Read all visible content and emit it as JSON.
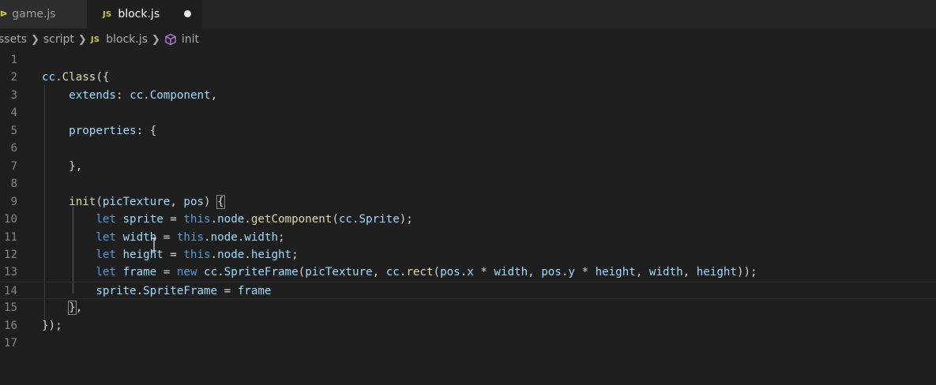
{
  "tabs": [
    {
      "label": "game.js",
      "icon": "js-file-icon",
      "active": false
    },
    {
      "label": "block.js",
      "icon": "js-file-icon",
      "active": true,
      "modified": true
    }
  ],
  "breadcrumb": {
    "segments": [
      "ssets",
      "script",
      "block.js",
      "init"
    ],
    "js_icon_text": "JS"
  },
  "editor": {
    "lines": [
      {
        "n": "1",
        "tokens": []
      },
      {
        "n": "2",
        "tokens": [
          [
            "id",
            "cc"
          ],
          [
            "punc",
            "."
          ],
          [
            "fn",
            "Class"
          ],
          [
            "punc",
            "({"
          ]
        ]
      },
      {
        "n": "3",
        "tokens": [
          [
            "punc",
            "    "
          ],
          [
            "id",
            "extends"
          ],
          [
            "punc",
            ": "
          ],
          [
            "id",
            "cc"
          ],
          [
            "punc",
            "."
          ],
          [
            "id",
            "Component"
          ],
          [
            "punc",
            ","
          ]
        ]
      },
      {
        "n": "4",
        "tokens": []
      },
      {
        "n": "5",
        "tokens": [
          [
            "punc",
            "    "
          ],
          [
            "id",
            "properties"
          ],
          [
            "punc",
            ": {"
          ]
        ]
      },
      {
        "n": "6",
        "tokens": []
      },
      {
        "n": "7",
        "tokens": [
          [
            "punc",
            "    },"
          ]
        ]
      },
      {
        "n": "8",
        "tokens": []
      },
      {
        "n": "9",
        "tokens": [
          [
            "punc",
            "    "
          ],
          [
            "fn",
            "init"
          ],
          [
            "punc",
            "("
          ],
          [
            "id",
            "picTexture"
          ],
          [
            "punc",
            ", "
          ],
          [
            "id",
            "pos"
          ],
          [
            "punc",
            ") "
          ],
          [
            "hl",
            "{"
          ]
        ]
      },
      {
        "n": "10",
        "tokens": [
          [
            "punc",
            "        "
          ],
          [
            "kw",
            "let"
          ],
          [
            "punc",
            " "
          ],
          [
            "id",
            "sprite"
          ],
          [
            "punc",
            " = "
          ],
          [
            "kw",
            "this"
          ],
          [
            "punc",
            "."
          ],
          [
            "id",
            "node"
          ],
          [
            "punc",
            "."
          ],
          [
            "fn",
            "getComponent"
          ],
          [
            "punc",
            "("
          ],
          [
            "id",
            "cc"
          ],
          [
            "punc",
            "."
          ],
          [
            "id",
            "Sprite"
          ],
          [
            "punc",
            ");"
          ]
        ]
      },
      {
        "n": "11",
        "tokens": [
          [
            "punc",
            "        "
          ],
          [
            "kw",
            "let"
          ],
          [
            "punc",
            " "
          ],
          [
            "id",
            "width"
          ],
          [
            "punc",
            " = "
          ],
          [
            "kw",
            "this"
          ],
          [
            "punc",
            "."
          ],
          [
            "id",
            "node"
          ],
          [
            "punc",
            "."
          ],
          [
            "id",
            "width"
          ],
          [
            "punc",
            ";"
          ]
        ]
      },
      {
        "n": "12",
        "tokens": [
          [
            "punc",
            "        "
          ],
          [
            "kw",
            "let"
          ],
          [
            "punc",
            " "
          ],
          [
            "id",
            "height"
          ],
          [
            "punc",
            " = "
          ],
          [
            "kw",
            "this"
          ],
          [
            "punc",
            "."
          ],
          [
            "id",
            "node"
          ],
          [
            "punc",
            "."
          ],
          [
            "id",
            "height"
          ],
          [
            "punc",
            ";"
          ]
        ]
      },
      {
        "n": "13",
        "tokens": [
          [
            "punc",
            "        "
          ],
          [
            "kw",
            "let"
          ],
          [
            "punc",
            " "
          ],
          [
            "id",
            "frame"
          ],
          [
            "punc",
            " = "
          ],
          [
            "kw",
            "new"
          ],
          [
            "punc",
            " "
          ],
          [
            "id",
            "cc"
          ],
          [
            "punc",
            "."
          ],
          [
            "id",
            "SpriteFrame"
          ],
          [
            "punc",
            "("
          ],
          [
            "id",
            "picTexture"
          ],
          [
            "punc",
            ", "
          ],
          [
            "id",
            "cc"
          ],
          [
            "punc",
            "."
          ],
          [
            "fn",
            "rect"
          ],
          [
            "punc",
            "("
          ],
          [
            "id",
            "pos"
          ],
          [
            "punc",
            "."
          ],
          [
            "id",
            "x"
          ],
          [
            "punc",
            " * "
          ],
          [
            "id",
            "width"
          ],
          [
            "punc",
            ", "
          ],
          [
            "id",
            "pos"
          ],
          [
            "punc",
            "."
          ],
          [
            "id",
            "y"
          ],
          [
            "punc",
            " * "
          ],
          [
            "id",
            "height"
          ],
          [
            "punc",
            ", "
          ],
          [
            "id",
            "width"
          ],
          [
            "punc",
            ", "
          ],
          [
            "id",
            "height"
          ],
          [
            "punc",
            "));"
          ]
        ]
      },
      {
        "n": "14",
        "tokens": [
          [
            "punc",
            "        "
          ],
          [
            "id",
            "sprite"
          ],
          [
            "punc",
            "."
          ],
          [
            "id",
            "SpriteFrame"
          ],
          [
            "punc",
            " = "
          ],
          [
            "id",
            "frame"
          ]
        ]
      },
      {
        "n": "15",
        "tokens": [
          [
            "punc",
            "    "
          ],
          [
            "hl",
            "}"
          ],
          [
            "punc",
            ","
          ]
        ]
      },
      {
        "n": "16",
        "tokens": [
          [
            "punc",
            "});"
          ]
        ]
      },
      {
        "n": "17",
        "tokens": []
      }
    ]
  },
  "colors": {
    "background": "#1e1e1e",
    "identifier": "#9cdcfe",
    "function": "#dcdcaa",
    "keyword": "#569cd6",
    "line_number": "#858585",
    "js_icon": "#cbcb41"
  }
}
